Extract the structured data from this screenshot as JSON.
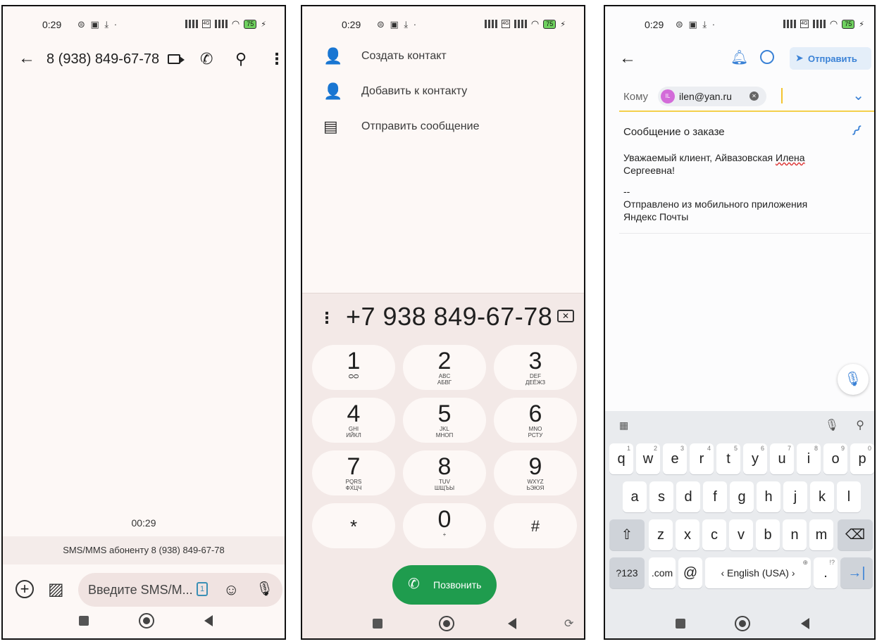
{
  "status": {
    "time": "0:29",
    "battery": "75"
  },
  "p1": {
    "contact": "8 (938) 849-67-78",
    "timestamp": "00:29",
    "sms_info": "SMS/MMS абоненту 8 (938) 849-67-78",
    "compose_placeholder": "Введите SMS/M...",
    "sim_slot": "1"
  },
  "p2": {
    "menu": [
      {
        "label": "Создать контакт",
        "icon": "person-add-icon"
      },
      {
        "label": "Добавить к контакту",
        "icon": "person-add-icon"
      },
      {
        "label": "Отправить сообщение",
        "icon": "message-icon"
      }
    ],
    "dialed_number": "+7 938 849-67-78",
    "keys": [
      {
        "digit": "1",
        "lat": "",
        "cyr": ""
      },
      {
        "digit": "2",
        "lat": "ABC",
        "cyr": "АБВГ"
      },
      {
        "digit": "3",
        "lat": "DEF",
        "cyr": "ДЕЁЖЗ"
      },
      {
        "digit": "4",
        "lat": "GHI",
        "cyr": "ИЙКЛ"
      },
      {
        "digit": "5",
        "lat": "JKL",
        "cyr": "МНОП"
      },
      {
        "digit": "6",
        "lat": "MNO",
        "cyr": "РСТУ"
      },
      {
        "digit": "7",
        "lat": "PQRS",
        "cyr": "ФХЦЧ"
      },
      {
        "digit": "8",
        "lat": "TUV",
        "cyr": "ШЩЪЫ"
      },
      {
        "digit": "9",
        "lat": "WXYZ",
        "cyr": "ЬЭЮЯ"
      },
      {
        "digit": "*",
        "lat": "",
        "cyr": ""
      },
      {
        "digit": "0",
        "lat": "+",
        "cyr": ""
      },
      {
        "digit": "#",
        "lat": "",
        "cyr": ""
      }
    ],
    "call_label": "Позвонить"
  },
  "p3": {
    "send_label": "Отправить",
    "to_label": "Кому",
    "recipient_initials": "IL",
    "recipient_email": "ilen@yan.ru",
    "subject": "Сообщение о заказе",
    "body_line1": "Уважаемый клиент, Айвазовская ",
    "body_underlined": "Илена",
    "body_line2": "Сергеевна!",
    "body_sep": "--",
    "body_sig1": "Отправлено из мобильного приложения",
    "body_sig2": "Яндекс Почты",
    "keyboard": {
      "row1": [
        [
          "q",
          "1"
        ],
        [
          "w",
          "2"
        ],
        [
          "e",
          "3"
        ],
        [
          "r",
          "4"
        ],
        [
          "t",
          "5"
        ],
        [
          "y",
          "6"
        ],
        [
          "u",
          "7"
        ],
        [
          "i",
          "8"
        ],
        [
          "o",
          "9"
        ],
        [
          "p",
          "0"
        ]
      ],
      "row2": [
        "a",
        "s",
        "d",
        "f",
        "g",
        "h",
        "j",
        "k",
        "l"
      ],
      "row3": [
        "z",
        "x",
        "c",
        "v",
        "b",
        "n",
        "m"
      ],
      "sym": "?123",
      "com": ".com",
      "at": "@",
      "space": "‹ English (USA) ›",
      "period": ".",
      "period_hint": "!?"
    }
  }
}
